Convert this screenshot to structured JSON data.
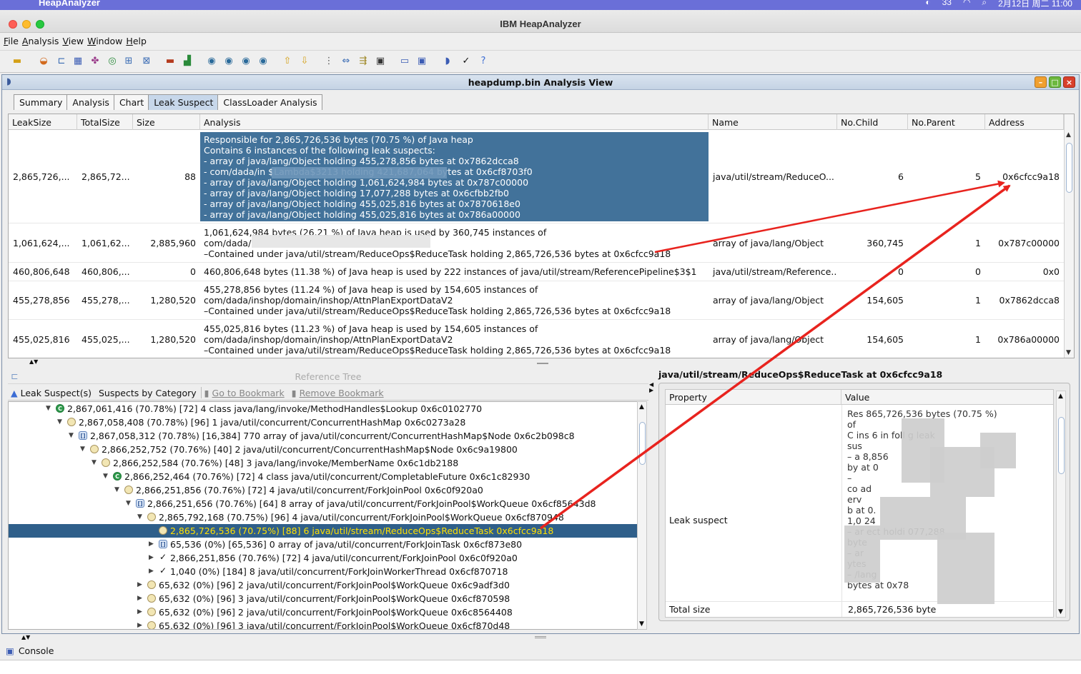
{
  "mac_menubar": {
    "app_name": "HeapAnalyzer",
    "tray_badge": "33",
    "clock": "2月12日 周二 11:00"
  },
  "window": {
    "title": "IBM HeapAnalyzer"
  },
  "menu": [
    "File",
    "Analysis",
    "View",
    "Window",
    "Help"
  ],
  "toolbar_icons": [
    "open-folder-icon",
    "heap-icon",
    "tree-icon",
    "grid-icon",
    "objects-icon",
    "refresh-icon",
    "hierarchy-icon",
    "find-icon",
    "size-icon",
    "chart-icon",
    "zoom-icon",
    "zoom-in-icon",
    "zoom-out-icon",
    "search-icon",
    "up-icon",
    "down-icon",
    "collapse-icon",
    "expand-icon",
    "expand-all-icon",
    "window-icon",
    "minus-icon",
    "monitor-icon",
    "bookmark-icon",
    "check-icon",
    "help-icon"
  ],
  "frame": {
    "title": "heapdump.bin Analysis View",
    "tabs": [
      "Summary",
      "Analysis",
      "Chart",
      "Leak Suspect",
      "ClassLoader Analysis"
    ],
    "active_tab": "Leak Suspect"
  },
  "leak_table": {
    "columns": [
      "LeakSize",
      "TotalSize",
      "Size",
      "Analysis",
      "Name",
      "No.Child",
      "No.Parent",
      "Address"
    ],
    "rows": [
      {
        "leak_size": "2,865,726,...",
        "total_size": "2,865,72...",
        "size": "88",
        "analysis": [
          "Responsible for 2,865,726,536 bytes (70.75 %) of Java heap",
          "Contains 6 instances of the following leak suspects:",
          "- array of java/lang/Object holding 455,278,856 bytes at 0x7862dcca8",
          "- com/dada/in                                    $Lambda$3213 holding 421,687,064 bytes at 0x6cf8703f0",
          "- array of java/lang/Object holding 1,061,624,984 bytes at 0x787c00000",
          "- array of java/lang/Object holding 17,077,288 bytes at 0x6cfbb2fb0",
          "- array of java/lang/Object holding 455,025,816 bytes at 0x7870618e0",
          "- array of java/lang/Object holding 455,025,816 bytes at 0x786a00000"
        ],
        "name": "java/util/stream/ReduceO...",
        "no_child": "6",
        "no_parent": "5",
        "address": "0x6cfcc9a18"
      },
      {
        "leak_size": "1,061,624,...",
        "total_size": "1,061,62...",
        "size": "2,885,960",
        "analysis": [
          "1,061,624,984 bytes (26.21 %) of Java heap is used by 360,745 instances of",
          "com/dada/",
          "–Contained under java/util/stream/ReduceOps$ReduceTask holding 2,865,726,536 bytes at 0x6cfcc9a18"
        ],
        "name": "array of java/lang/Object",
        "no_child": "360,745",
        "no_parent": "1",
        "address": "0x787c00000"
      },
      {
        "leak_size": "460,806,648",
        "total_size": "460,806,...",
        "size": "0",
        "analysis": [
          "460,806,648 bytes (11.38 %) of Java heap is used by 222 instances of java/util/stream/ReferencePipeline$3$1"
        ],
        "name": "java/util/stream/Reference...",
        "no_child": "0",
        "no_parent": "0",
        "address": "0x0"
      },
      {
        "leak_size": "455,278,856",
        "total_size": "455,278,...",
        "size": "1,280,520",
        "analysis": [
          "455,278,856 bytes (11.24 %) of Java heap is used by 154,605 instances of",
          "com/dada/inshop/domain/inshop/AttnPlanExportDataV2",
          "–Contained under java/util/stream/ReduceOps$ReduceTask holding 2,865,726,536 bytes at 0x6cfcc9a18"
        ],
        "name": "array of java/lang/Object",
        "no_child": "154,605",
        "no_parent": "1",
        "address": "0x7862dcca8"
      },
      {
        "leak_size": "455,025,816",
        "total_size": "455,025,...",
        "size": "1,280,520",
        "analysis": [
          "455,025,816 bytes (11.23 %) of Java heap is used by 154,605 instances of",
          "com/dada/inshop/domain/inshop/AttnPlanExportDataV2",
          "–Contained under java/util/stream/ReduceOps$ReduceTask holding 2,865,726,536 bytes at 0x6cfcc9a18"
        ],
        "name": "array of java/lang/Object",
        "no_child": "154,605",
        "no_parent": "1",
        "address": "0x786a00000"
      }
    ]
  },
  "reference_tree": {
    "title": "Reference Tree",
    "tools": [
      "Leak Suspect(s)",
      "Suspects by Category",
      "Go to Bookmark",
      "Remove Bookmark"
    ],
    "nodes": [
      {
        "text": "2,867,061,416 (70.78%) [72] 4 class java/lang/invoke/MethodHandles$Lookup 0x6c0102770",
        "icon": "class-icon"
      },
      {
        "text": "2,867,058,408 (70.78%) [96] 1 java/util/concurrent/ConcurrentHashMap 0x6c0273a28",
        "icon": "object-icon"
      },
      {
        "text": "2,867,058,312 (70.78%) [16,384] 770 array of java/util/concurrent/ConcurrentHashMap$Node 0x6c2b098c8",
        "icon": "array-icon"
      },
      {
        "text": "2,866,252,752 (70.76%) [40] 2 java/util/concurrent/ConcurrentHashMap$Node 0x6c9a19800",
        "icon": "object-icon"
      },
      {
        "text": "2,866,252,584 (70.76%) [48] 3 java/lang/invoke/MemberName 0x6c1db2188",
        "icon": "object-icon"
      },
      {
        "text": "2,866,252,464 (70.76%) [72] 4 class java/util/concurrent/CompletableFuture 0x6c1c82930",
        "icon": "class-icon"
      },
      {
        "text": "2,866,251,856 (70.76%) [72] 4 java/util/concurrent/ForkJoinPool 0x6c0f920a0",
        "icon": "object-icon"
      },
      {
        "text": "2,866,251,656 (70.76%) [64] 8 array of java/util/concurrent/ForkJoinPool$WorkQueue 0x6cf85643d8",
        "icon": "array-icon"
      },
      {
        "text": "2,865,792,168 (70.75%) [96] 4 java/util/concurrent/ForkJoinPool$WorkQueue 0x6cf870948",
        "icon": "object-icon"
      },
      {
        "text": "2,865,726,536 (70.75%) [88] 6 java/util/stream/ReduceOps$ReduceTask 0x6cfcc9a18",
        "icon": "object-icon"
      },
      {
        "text": "65,536 (0%) [65,536] 0 array of java/util/concurrent/ForkJoinTask 0x6cf873e80",
        "icon": "array-icon"
      },
      {
        "text": "2,866,251,856 (70.76%) [72] 4 java/util/concurrent/ForkJoinPool 0x6c0f920a0",
        "icon": "check-icon"
      },
      {
        "text": "1,040 (0%) [184] 8 java/util/concurrent/ForkJoinWorkerThread 0x6cf870718",
        "icon": "check-icon"
      },
      {
        "text": "65,632 (0%) [96] 2 java/util/concurrent/ForkJoinPool$WorkQueue 0x6c9adf3d0",
        "icon": "object-icon"
      },
      {
        "text": "65,632 (0%) [96] 3 java/util/concurrent/ForkJoinPool$WorkQueue 0x6cf870598",
        "icon": "object-icon"
      },
      {
        "text": "65,632 (0%) [96] 2 java/util/concurrent/ForkJoinPool$WorkQueue 0x6c8564408",
        "icon": "object-icon"
      },
      {
        "text": "65,632 (0%) [96] 3 java/util/concurrent/ForkJoinPool$WorkQueue 0x6cf870d48",
        "icon": "object-icon"
      }
    ]
  },
  "details": {
    "title": "java/util/stream/ReduceOps$ReduceTask at 0x6cfcc9a18",
    "columns": [
      "Property",
      "Value"
    ],
    "rows": [
      {
        "property": "Leak suspect",
        "value_lines": [
          "Res        865,726,536 bytes (70.75 %)",
          "of",
          "C   ins 6 in          foll   g leak",
          "sus",
          "– a           8,856",
          "by    at 0",
          "–",
          "co     ad",
          "erv",
          "b    at 0.",
          "1,0    24",
          "– ar            ect holdi     077,288",
          "byte",
          "– ar",
          "ytes",
          "–             /lang",
          "bytes at 0x78"
        ]
      },
      {
        "property": "Total size",
        "value": "2,865,726,536 byte"
      }
    ]
  },
  "console": {
    "label": "Console"
  },
  "colors": {
    "annotation_arrow": "#e8231e",
    "selection": "#42729a",
    "tree_selection_text": "#ffe000"
  }
}
